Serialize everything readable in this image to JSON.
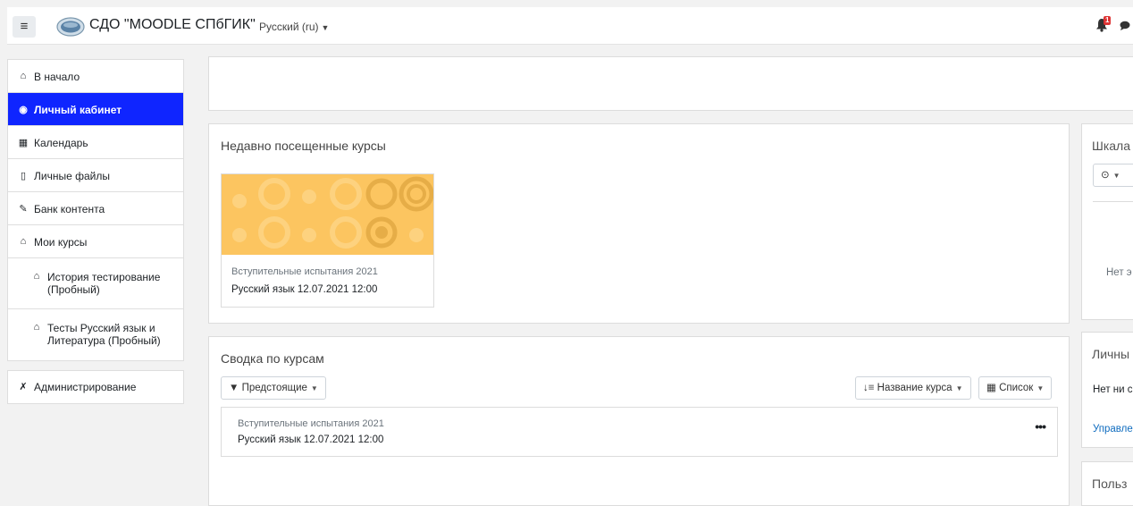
{
  "header": {
    "menu_icon": "hamburger-icon",
    "site_name": "СДО \"MOODLE СПбГИК\"",
    "language": "Русский ‎(ru)‎",
    "notification_count": "1",
    "notification_icon": "bell-icon",
    "messages_icon": "chat-icon"
  },
  "nav": {
    "items": [
      {
        "label": "В начало",
        "icon": "home-icon"
      },
      {
        "label": "Личный кабинет",
        "icon": "dashboard-icon"
      },
      {
        "label": "Календарь",
        "icon": "calendar-icon"
      },
      {
        "label": "Личные файлы",
        "icon": "file-icon"
      },
      {
        "label": "Банк контента",
        "icon": "paintbrush-icon"
      },
      {
        "label": "Мои курсы",
        "icon": "graduation-cap-icon"
      },
      {
        "label": "История тестирование (Пробный)",
        "icon": "graduation-cap-icon"
      },
      {
        "label": "Тесты Русский язык и Литература (Пробный)",
        "icon": "graduation-cap-icon"
      }
    ],
    "admin_label": "Администрирование",
    "admin_icon": "wrench-icon"
  },
  "recent": {
    "title": "Недавно посещенные курсы",
    "course_category": "Вступительные испытания 2021",
    "course_name": "Русский язык 12.07.2021 12:00"
  },
  "overview": {
    "title": "Сводка по курсам",
    "filter_label": "Предстоящие",
    "sort_label": "Название курса",
    "view_label": "Список",
    "row_category": "Вступительные испытания 2021",
    "row_name": "Русский язык 12.07.2021 12:00",
    "row_menu": "•••"
  },
  "right": {
    "timeline_title": "Шкала",
    "timeline_empty": "Нет э",
    "private_files_title": "Личны",
    "private_files_text": "Нет ни с",
    "manage_link": "Управле",
    "users_title": "Польз"
  },
  "colors": {
    "accent": "#0f25ff",
    "course_image": "#fcc560",
    "badge": "#dd3333",
    "link": "#0f6cbf"
  }
}
